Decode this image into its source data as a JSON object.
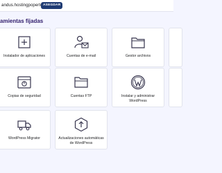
{
  "header": {
    "domain": "andus.hostingpoperto.ser",
    "badge": "ASEGDAR"
  },
  "section": {
    "title": "amientas fijadas"
  },
  "tools": [
    {
      "label": "Instalador de aplicaciones",
      "icon": "app-installer-icon"
    },
    {
      "label": "Cuentas de e-mail",
      "icon": "email-accounts-icon"
    },
    {
      "label": "Gestor archivos",
      "icon": "file-manager-icon"
    },
    {
      "label": "Copias de seguridad",
      "icon": "backup-icon"
    },
    {
      "label": "Cuentas FTP",
      "icon": "ftp-folder-icon"
    },
    {
      "label": "Instalar y administrar WordPress",
      "icon": "wordpress-icon"
    },
    {
      "label": "WordPress Migrator",
      "icon": "migrator-truck-icon"
    },
    {
      "label": "Actualizaciones automáticas de WordPress",
      "icon": "auto-update-icon"
    }
  ],
  "colors": {
    "icon_stroke": "#36344d",
    "text": "#1d1e20",
    "title": "#2f1c6a",
    "badge_bg": "#1f3b73",
    "page_bg": "#f4f5ff"
  }
}
